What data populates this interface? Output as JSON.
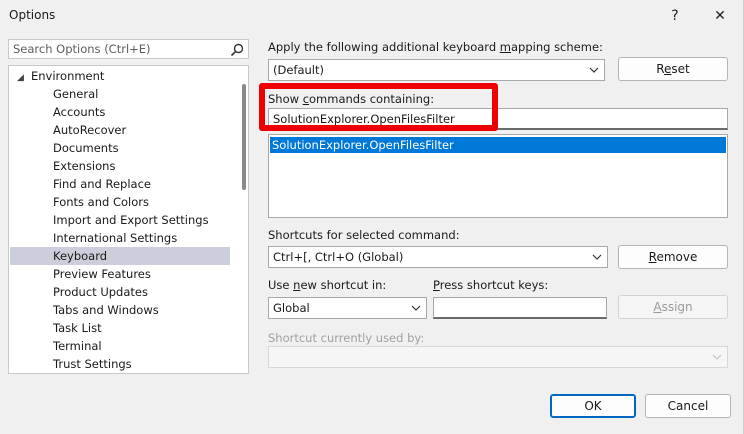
{
  "window": {
    "title": "Options",
    "help": "?",
    "close": "✕"
  },
  "search": {
    "placeholder": "Search Options (Ctrl+E)"
  },
  "tree": {
    "root": "Environment",
    "children": [
      "General",
      "Accounts",
      "AutoRecover",
      "Documents",
      "Extensions",
      "Find and Replace",
      "Fonts and Colors",
      "Import and Export Settings",
      "International Settings",
      "Keyboard",
      "Preview Features",
      "Product Updates",
      "Tabs and Windows",
      "Task List",
      "Terminal",
      "Trust Settings"
    ],
    "selected": "Keyboard"
  },
  "keyboard": {
    "scheme_label_pre": "Apply the following additional keyboard ",
    "scheme_label_u": "m",
    "scheme_label_post": "apping scheme:",
    "scheme_value": "(Default)",
    "reset_pre": "R",
    "reset_u": "e",
    "reset_post": "set",
    "show_label_pre": "Show ",
    "show_label_u": "c",
    "show_label_post": "ommands containing:",
    "command_filter": "SolutionExplorer.OpenFilesFilter",
    "commands": [
      "SolutionExplorer.OpenFilesFilter"
    ],
    "shortcuts_label_pre": "Shortcuts for selected command:",
    "shortcut_value": "Ctrl+[, Ctrl+O (Global)",
    "remove_pre": "",
    "remove_u": "R",
    "remove_post": "emove",
    "use_label_pre": "Use ",
    "use_label_u": "n",
    "use_label_post": "ew shortcut in:",
    "use_value": "Global",
    "press_label_pre": "",
    "press_label_u": "P",
    "press_label_post": "ress shortcut keys:",
    "assign_pre": "",
    "assign_u": "A",
    "assign_post": "ssign",
    "used_by_label": "Shortcut currently used by:"
  },
  "footer": {
    "ok": "OK",
    "cancel": "Cancel"
  },
  "colors": {
    "highlight": "#ee0000",
    "selection": "#0078d7",
    "tree_selection": "#cccedb"
  }
}
